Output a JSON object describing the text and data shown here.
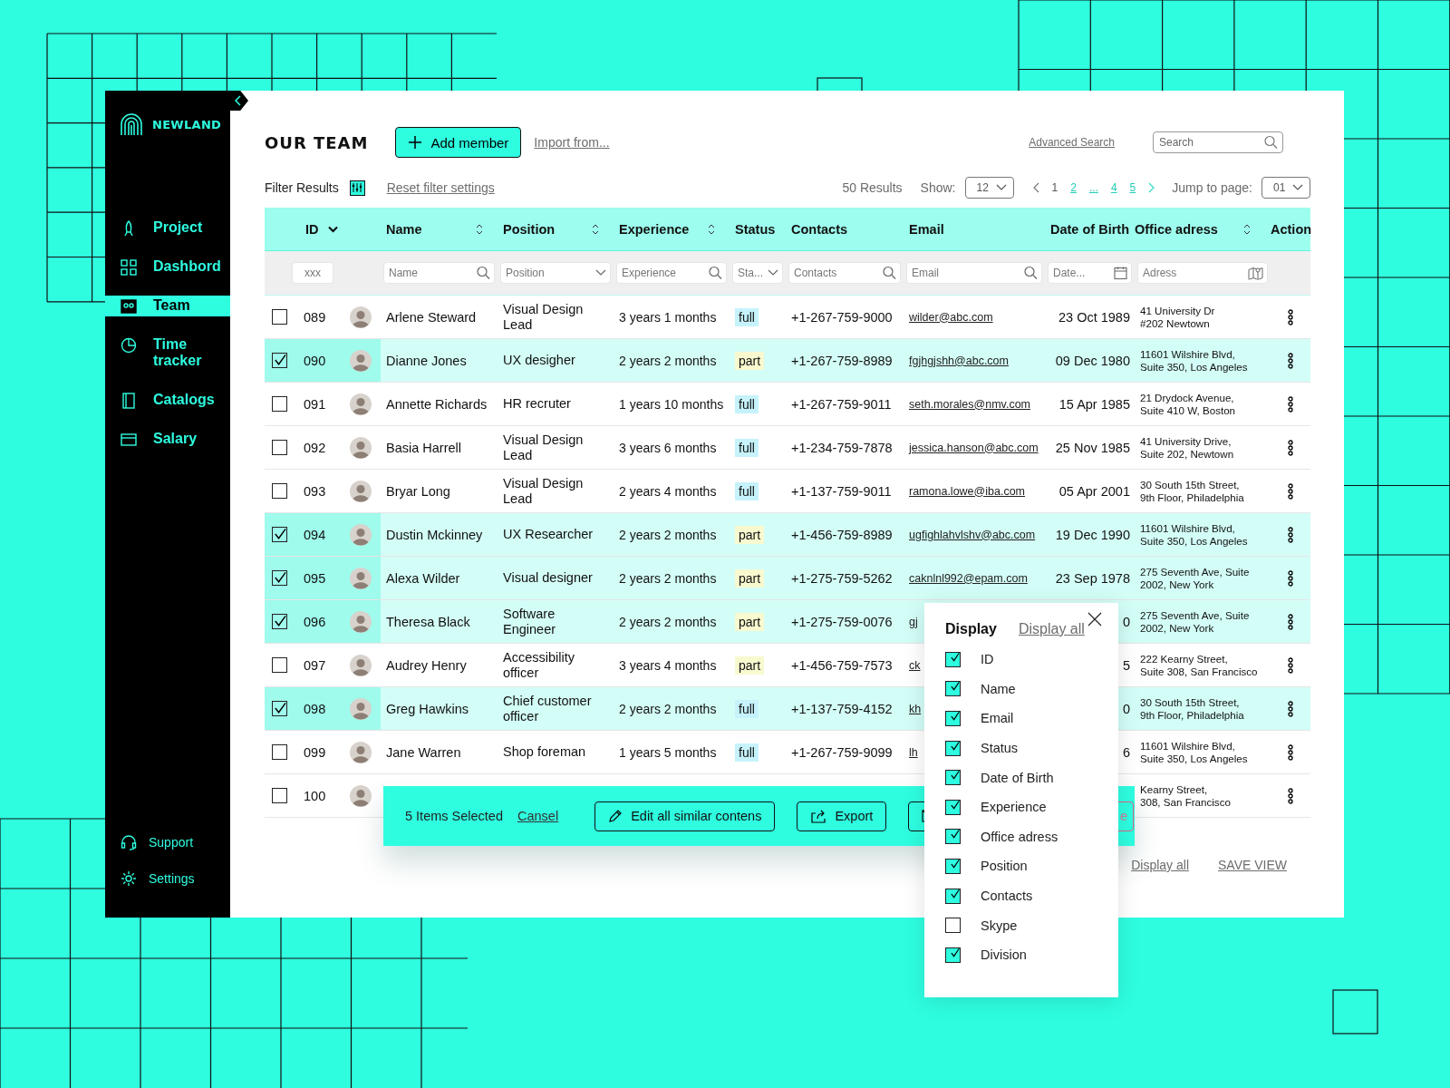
{
  "sidebar": {
    "brand": "NEWLAND",
    "items": [
      {
        "label": "Project",
        "selected": false
      },
      {
        "label": "Dashbord",
        "selected": false
      },
      {
        "label": "Team",
        "selected": true
      },
      {
        "label": "Time tracker",
        "selected": false
      },
      {
        "label": "Catalogs",
        "selected": false
      },
      {
        "label": "Salary",
        "selected": false
      }
    ],
    "footer_items": [
      {
        "label": "Support"
      },
      {
        "label": "Settings"
      }
    ]
  },
  "header": {
    "title": "OUR TEAM",
    "add_button": "Add member",
    "import_link": "Import from...",
    "advanced_search": "Advanced Search",
    "search": {
      "placeholder": "Search"
    }
  },
  "filter_bar": {
    "label": "Filter Results",
    "reset_link": "Reset filter settings",
    "results": "50 Results",
    "show_label": "Show:",
    "show_value": "12",
    "pages": [
      {
        "label": "1",
        "selected": true
      },
      {
        "label": "2",
        "selected": false
      },
      {
        "label": "...",
        "selected": false
      },
      {
        "label": "4",
        "selected": false
      },
      {
        "label": "5",
        "selected": false
      }
    ],
    "jump_label": "Jump to page:",
    "jump_value": "01"
  },
  "table": {
    "columns": [
      {
        "label": "ID",
        "kind": "dropdown"
      },
      {
        "label": "Name",
        "kind": "sort"
      },
      {
        "label": "Position",
        "kind": "sort"
      },
      {
        "label": "Experience",
        "kind": "sort"
      },
      {
        "label": "Status",
        "kind": "plain"
      },
      {
        "label": "Contacts",
        "kind": "plain"
      },
      {
        "label": "Email",
        "kind": "plain"
      },
      {
        "label": "Date of Birth",
        "kind": "plain"
      },
      {
        "label": "Office adress",
        "kind": "sort"
      },
      {
        "label": "Action",
        "kind": "plain"
      }
    ],
    "filters": [
      {
        "placeholder": "xxx",
        "kind": "plain"
      },
      {
        "placeholder": "Name",
        "kind": "search"
      },
      {
        "placeholder": "Position",
        "kind": "dropdown"
      },
      {
        "placeholder": "Experience",
        "kind": "search"
      },
      {
        "placeholder": "Sta...",
        "kind": "dropdown"
      },
      {
        "placeholder": "Contacts",
        "kind": "search"
      },
      {
        "placeholder": "Email",
        "kind": "search"
      },
      {
        "placeholder": "Date...",
        "kind": "date"
      },
      {
        "placeholder": "Adress",
        "kind": "map"
      }
    ],
    "rows": [
      {
        "selected": false,
        "id": "089",
        "name": "Arlene Steward",
        "position": "Visual Design Lead",
        "experience": "3 years 1 months",
        "status": {
          "label": "full",
          "color": "#c6f3fb"
        },
        "contact": "+1-267-759-9000",
        "email": "wilder@abc.com",
        "birth": "23 Oct 1989",
        "address": [
          "41 University Dr",
          "#202 Newtown"
        ]
      },
      {
        "selected": true,
        "id": "090",
        "name": "Dianne Jones",
        "position": "UX desigher",
        "experience": "2 years 2 months",
        "status": {
          "label": "part",
          "color": "#f8f9cf"
        },
        "contact": "+1-267-759-8989",
        "email": "fgjhgjshh@abc.com",
        "birth": "09 Dec 1980",
        "address": [
          "11601 Wilshire Blvd,",
          "Suite 350, Los Angeles"
        ]
      },
      {
        "selected": false,
        "id": "091",
        "name": "Annette Richards",
        "position": "HR recruter",
        "experience": "1 years 10 months",
        "status": {
          "label": "full",
          "color": "#c6f3fb"
        },
        "contact": "+1-267-759-9011",
        "email": "seth.morales@nmv.com",
        "birth": "15 Apr 1985",
        "address": [
          "21 Drydock Avenue,",
          "Suite 410 W, Boston"
        ]
      },
      {
        "selected": false,
        "id": "092",
        "name": "Basia Harrell",
        "position": "Visual Design Lead",
        "experience": "3 years 6 months",
        "status": {
          "label": "full",
          "color": "#c6f3fb"
        },
        "contact": "+1-234-759-7878",
        "email": "jessica.hanson@abc.com",
        "birth": "25 Nov 1985",
        "address": [
          "41 University Drive,",
          "Suite 202, Newtown"
        ]
      },
      {
        "selected": false,
        "id": "093",
        "name": "Bryar Long",
        "position": "Visual Design Lead",
        "experience": "2 years 4 months",
        "status": {
          "label": "full",
          "color": "#c6f3fb"
        },
        "contact": "+1-137-759-9011",
        "email": "ramona.lowe@iba.com",
        "birth": "05 Apr 2001",
        "address": [
          "30 South 15th Street,",
          "9th Floor, Philadelphia"
        ]
      },
      {
        "selected": true,
        "id": "094",
        "name": "Dustin Mckinney",
        "position": "UX Researcher",
        "experience": "2 years 2 months",
        "status": {
          "label": "part",
          "color": "#f8f9cf"
        },
        "contact": "+1-456-759-8989",
        "email": "ugfighlahvlshv@abc.com",
        "birth": "19 Dec 1990",
        "address": [
          "11601 Wilshire Blvd,",
          "Suite 350, Los Angeles"
        ]
      },
      {
        "selected": true,
        "id": "095",
        "name": "Alexa Wilder",
        "position": "Visual designer",
        "experience": "2 years 2 months",
        "status": {
          "label": "part",
          "color": "#f8f9cf"
        },
        "contact": "+1-275-759-5262",
        "email": "caknlnl992@epam.com",
        "birth": "23 Sep 1978",
        "address": [
          "275 Seventh Ave, Suite",
          "2002, New York"
        ]
      },
      {
        "selected": true,
        "id": "096",
        "name": "Theresa Black",
        "position": "Software Engineer",
        "experience": "2 years 2 months",
        "status": {
          "label": "part",
          "color": "#f8f9cf"
        },
        "contact": "+1-275-759-0076",
        "email": "gj",
        "birth": "0",
        "address": [
          "275 Seventh Ave, Suite",
          "2002, New York"
        ]
      },
      {
        "selected": false,
        "id": "097",
        "name": "Audrey Henry",
        "position": "Accessibility officer",
        "experience": "3 years 4 months",
        "status": {
          "label": "part",
          "color": "#f8f9cf"
        },
        "contact": "+1-456-759-7573",
        "email": "ck",
        "birth": "5",
        "address": [
          "222 Kearny Street,",
          "Suite 308, San Francisco"
        ]
      },
      {
        "selected": true,
        "id": "098",
        "name": "Greg Hawkins",
        "position": "Chief customer officer",
        "experience": "2 years 2 months",
        "status": {
          "label": "full",
          "color": "#c6f3fb"
        },
        "contact": "+1-137-759-4152",
        "email": "kh",
        "birth": "0",
        "address": [
          "30 South 15th Street,",
          "9th Floor, Philadelphia"
        ]
      },
      {
        "selected": false,
        "id": "099",
        "name": "Jane Warren",
        "position": "Shop foreman",
        "experience": "1 years 5 months",
        "status": {
          "label": "full",
          "color": "#c6f3fb"
        },
        "contact": "+1-267-759-9099",
        "email": "lh",
        "birth": "6",
        "address": [
          "11601 Wilshire Blvd,",
          "Suite 350, Los Angeles"
        ]
      },
      {
        "selected": false,
        "id": "100",
        "address": [
          "Kearny Street,",
          "308, San Francisco"
        ]
      }
    ]
  },
  "selection_bar": {
    "count": "5 Items Selected",
    "cancel": "Cansel",
    "buttons": [
      {
        "kind": "edit",
        "label": "Edit all similar contens"
      },
      {
        "kind": "export",
        "label": "Export"
      },
      {
        "kind": "mail"
      },
      {
        "kind": "danger",
        "label": "e"
      }
    ]
  },
  "display_popup": {
    "title": "Display",
    "display_all": "Display all",
    "items": [
      {
        "label": "ID",
        "checked": true
      },
      {
        "label": "Name",
        "checked": true
      },
      {
        "label": "Email",
        "checked": true
      },
      {
        "label": "Status",
        "checked": true
      },
      {
        "label": "Date of Birth",
        "checked": true
      },
      {
        "label": "Experience",
        "checked": true
      },
      {
        "label": "Office adress",
        "checked": true
      },
      {
        "label": "Position",
        "checked": true
      },
      {
        "label": "Contacts",
        "checked": true
      },
      {
        "label": "Skype",
        "checked": false
      },
      {
        "label": "Division",
        "checked": true
      }
    ]
  },
  "footer": {
    "display_all": "Display all",
    "save_view": "SAVE VIEW"
  }
}
